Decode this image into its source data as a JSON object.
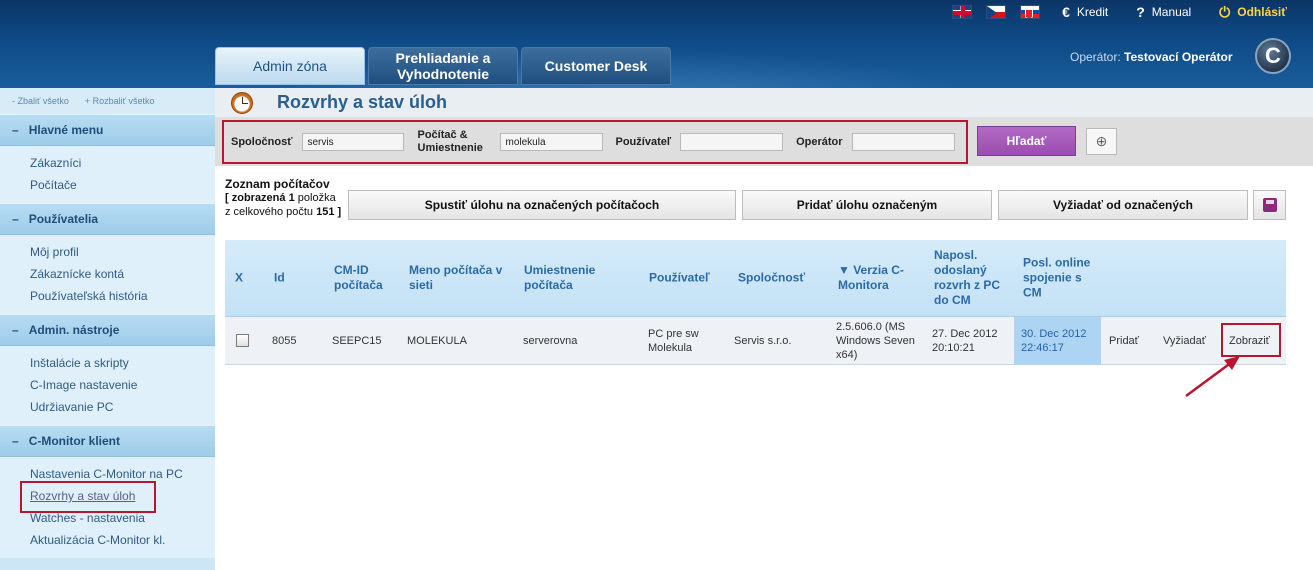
{
  "header": {
    "flags": [
      "flag-uk",
      "flag-cz",
      "flag-sk"
    ],
    "links": [
      {
        "icon": "€",
        "label": "Kredit"
      },
      {
        "icon": "?",
        "label": "Manual"
      },
      {
        "icon": "⏻",
        "label": "Odhlásiť"
      }
    ],
    "tabs": [
      {
        "label": "Admin zóna"
      },
      {
        "label": "Prehliadanie a Vyhodnotenie"
      },
      {
        "label": "Customer Desk"
      }
    ],
    "operator_label": "Operátor:",
    "operator_name": "Testovací Operátor",
    "logo_letter": "C"
  },
  "sidebar": {
    "collapse_all": "- Zbaliť všetko",
    "expand_all": "+ Rozbaliť všetko",
    "sections": [
      {
        "title": "Hlavné menu",
        "items": [
          "Zákazníci",
          "Počítače"
        ]
      },
      {
        "title": "Používatelia",
        "items": [
          "Môj profil",
          "Zákaznícke kontá",
          "Používateľská história"
        ]
      },
      {
        "title": "Admin. nástroje",
        "items": [
          "Inštalácie a skripty",
          "C-Image nastavenie",
          "Udržiavanie PC"
        ]
      },
      {
        "title": "C-Monitor klient",
        "items": [
          "Nastavenia C-Monitor na PC",
          "Rozvrhy a stav úloh",
          "Watches - nastavenia",
          "Aktualizácia C-Monitor kl."
        ]
      }
    ]
  },
  "page": {
    "title": "Rozvrhy a stav úloh"
  },
  "filter": {
    "company_label": "Spoločnosť",
    "company_value": "servis",
    "computer_label_1": "Počítač &",
    "computer_label_2": "Umiestnenie",
    "computer_value": "molekula",
    "user_label": "Používateľ",
    "user_value": "",
    "operator_label": "Operátor",
    "operator_value": "",
    "search_label": "Hľadať"
  },
  "list": {
    "title": "Zoznam počítačov",
    "info_prefix": "[ zobrazená",
    "shown": "1",
    "info_mid": "položka z celkového počtu",
    "total": "151",
    "info_suffix": "]",
    "actions": [
      "Spustiť úlohu na označených počítačoch",
      "Pridať úlohu označeným",
      "Vyžiadať od označených"
    ]
  },
  "table": {
    "columns": [
      "X",
      "Id",
      "CM-ID počítača",
      "Meno počítača v sieti",
      "Umiestnenie počítača",
      "Používateľ",
      "Spoločnosť",
      "▼ Verzia C-Monitora",
      "Naposl. odoslaný rozvrh z PC do CM",
      "Posl. online spojenie s CM"
    ],
    "rows": [
      {
        "id": "8055",
        "cmid": "SEEPC15",
        "name": "MOLEKULA",
        "location": "serverovna",
        "user": "PC pre sw Molekula",
        "company": "Servis s.r.o.",
        "version": "2.5.606.0 (MS Windows Seven x64)",
        "last_schedule": "27. Dec 2012 20:10:21",
        "last_online": "30. Dec 2012 22:46:17",
        "actions": [
          "Pridať",
          "Vyžiadať",
          "Zobraziť"
        ]
      }
    ]
  },
  "colors": {
    "accent_red": "#b8152e",
    "search_button": "#a45ab8",
    "header_blue": "#0e4a86"
  }
}
